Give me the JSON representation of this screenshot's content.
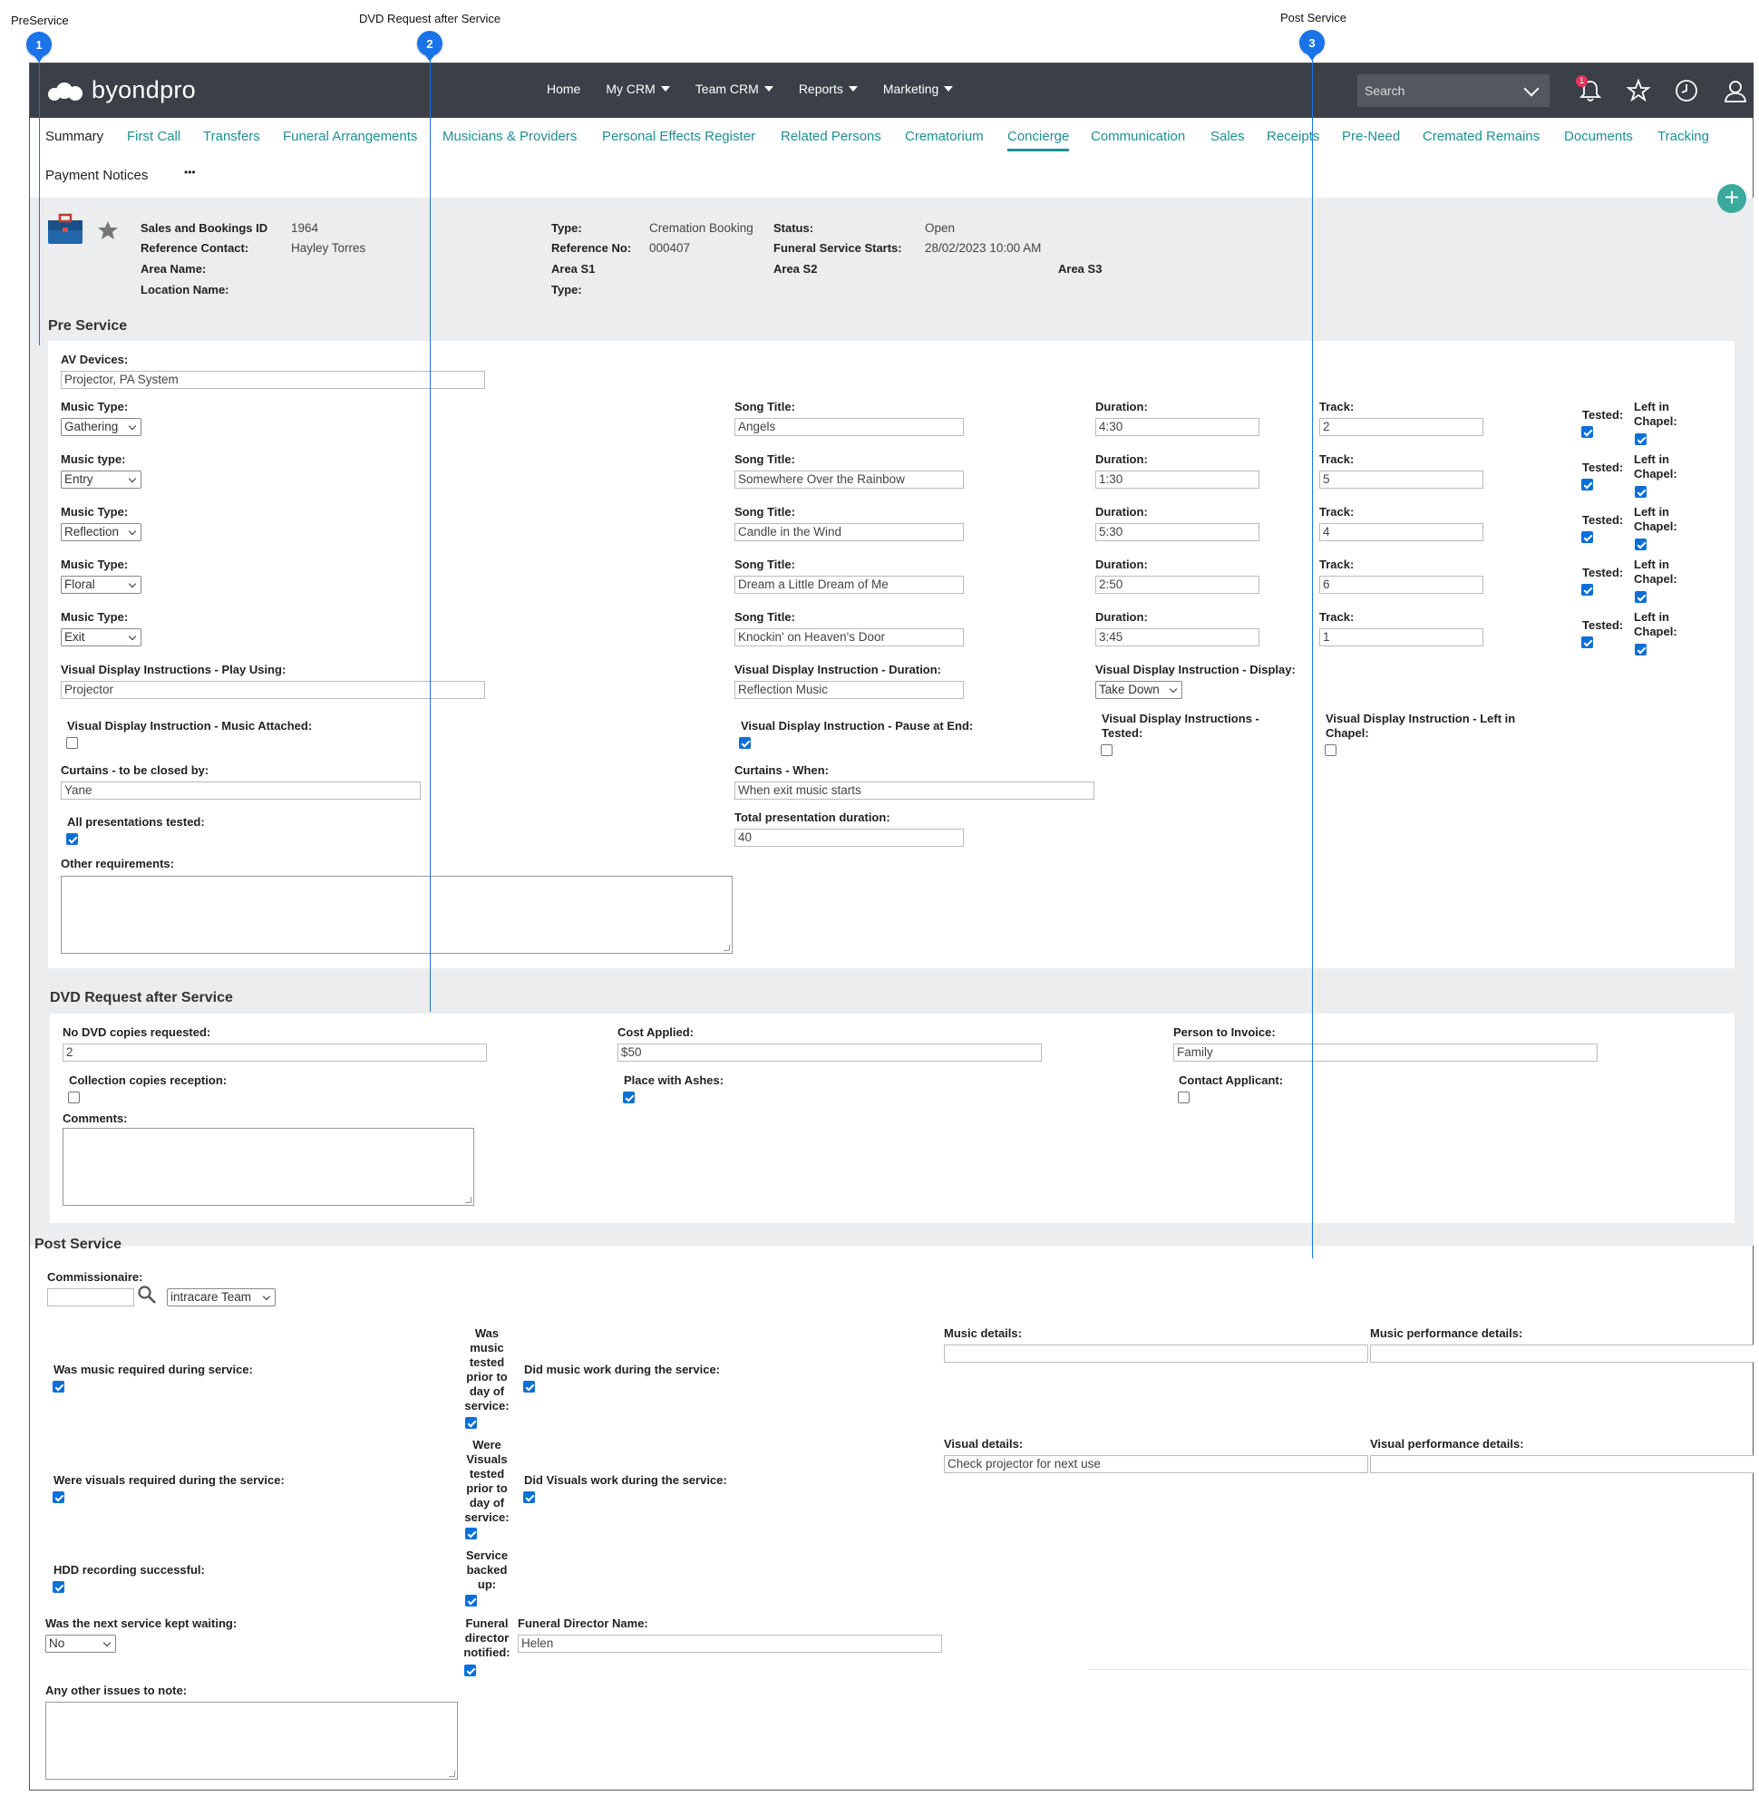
{
  "callouts": [
    {
      "number": "1",
      "label": "PreService"
    },
    {
      "number": "2",
      "label": "DVD Request after Service"
    },
    {
      "number": "3",
      "label": "Post Service"
    }
  ],
  "topbar": {
    "logo_text": "byondpro",
    "nav": [
      "Home",
      "My CRM",
      "Team CRM",
      "Reports",
      "Marketing"
    ],
    "search_placeholder": "Search",
    "notification_count": "1",
    "icons": [
      "bell-icon",
      "star-icon",
      "clock-icon",
      "user-icon"
    ]
  },
  "tabs": [
    "Summary",
    "First Call",
    "Transfers",
    "Funeral Arrangements",
    "Musicians & Providers",
    "Personal Effects Register",
    "Related Persons",
    "Crematorium",
    "Concierge",
    "Communication",
    "Sales",
    "Receipts",
    "Pre-Need",
    "Cremated Remains",
    "Documents",
    "Tracking",
    "Payment Notices",
    "•••"
  ],
  "active_tab": "Concierge",
  "record": {
    "id_label": "Sales and Bookings ID",
    "id_value": "1964",
    "ref_contact_label": "Reference Contact:",
    "ref_contact_value": "Hayley Torres",
    "area_name_label": "Area Name:",
    "location_name_label": "Location Name:",
    "type_label": "Type:",
    "type_value": "Cremation Booking",
    "ref_no_label": "Reference No:",
    "ref_no_value": "000407",
    "area_s1_label": "Area S1",
    "type2_label": "Type:",
    "status_label": "Status:",
    "status_value": "Open",
    "service_starts_label": "Funeral Service Starts:",
    "service_starts_value": "28/02/2023 10:00 AM",
    "area_s2_label": "Area S2",
    "area_s3_label": "Area S3"
  },
  "pre_service": {
    "title": "Pre Service",
    "av_devices_label": "AV Devices:",
    "av_devices_value": "Projector, PA System",
    "music_rows": [
      {
        "type_label": "Music Type:",
        "type": "Gathering",
        "song": "Angels",
        "duration": "4:30",
        "track": "2",
        "tested": true,
        "left": true
      },
      {
        "type_label": "Music type:",
        "type": "Entry",
        "song": "Somewhere Over the Rainbow",
        "duration": "1:30",
        "track": "5",
        "tested": true,
        "left": true
      },
      {
        "type_label": "Music Type:",
        "type": "Reflection",
        "song": "Candle in the Wind",
        "duration": "5:30",
        "track": "4",
        "tested": true,
        "left": true
      },
      {
        "type_label": "Music Type:",
        "type": "Floral",
        "song": "Dream a Little Dream of Me",
        "duration": "2:50",
        "track": "6",
        "tested": true,
        "left": true
      },
      {
        "type_label": "Music Type:",
        "type": "Exit",
        "song": "Knockin' on Heaven's Door",
        "duration": "3:45",
        "track": "1",
        "tested": true,
        "left": true
      }
    ],
    "song_title_label": "Song Title:",
    "duration_label": "Duration:",
    "track_label": "Track:",
    "tested_label": "Tested:",
    "left_in_chapel_label": "Left in Chapel:",
    "vd_play_using_label": "Visual Display Instructions - Play Using:",
    "vd_play_using_value": "Projector",
    "vd_duration_label": "Visual Display Instruction - Duration:",
    "vd_duration_value": "Reflection Music",
    "vd_display_label": "Visual Display Instruction - Display:",
    "vd_display_value": "Take Down",
    "vd_music_attached_label": "Visual Display Instruction - Music Attached:",
    "vd_music_attached": false,
    "vd_pause_label": "Visual Display Instruction - Pause at End:",
    "vd_pause": true,
    "vd_tested_label": "Visual Display Instructions - Tested:",
    "vd_tested": false,
    "vd_left_label": "Visual Display Instruction - Left in Chapel:",
    "vd_left": false,
    "curtains_by_label": "Curtains - to be closed by:",
    "curtains_by_value": "Yane",
    "curtains_when_label": "Curtains - When:",
    "curtains_when_value": "When exit music starts",
    "all_tested_label": "All presentations tested:",
    "all_tested": true,
    "total_duration_label": "Total presentation duration:",
    "total_duration_value": "40",
    "other_req_label": "Other requirements:"
  },
  "dvd": {
    "title": "DVD Request after Service",
    "copies_label": "No DVD copies requested:",
    "copies_value": "2",
    "cost_label": "Cost Applied:",
    "cost_value": "$50",
    "invoice_label": "Person to Invoice:",
    "invoice_value": "Family",
    "collection_label": "Collection copies reception:",
    "collection": false,
    "ashes_label": "Place with Ashes:",
    "ashes": true,
    "contact_label": "Contact Applicant:",
    "contact": false,
    "comments_label": "Comments:"
  },
  "post_service": {
    "title": "Post Service",
    "commissionaire_label": "Commissionaire:",
    "team_value": "intracare Team",
    "music_required_label": "Was music required during service:",
    "music_required": true,
    "music_tested_label": "Was music tested prior to day of service:",
    "music_tested": true,
    "music_worked_label": "Did music work during the service:",
    "music_worked": true,
    "music_details_label": "Music details:",
    "music_details_value": "",
    "music_perf_label": "Music performance details:",
    "visuals_required_label": "Were visuals required during the service:",
    "visuals_required": true,
    "visuals_tested_label": "Were Visuals tested prior to day of service:",
    "visuals_tested": true,
    "visuals_worked_label": "Did Visuals work during the service:",
    "visuals_worked": true,
    "visual_details_label": "Visual details:",
    "visual_details_value": "Check projector for next use",
    "visual_perf_label": "Visual performance details:",
    "hdd_label": "HDD recording successful:",
    "hdd": true,
    "backed_up_label": "Service backed up:",
    "backed_up": true,
    "kept_waiting_label": "Was the next service kept waiting:",
    "kept_waiting_value": "No",
    "fd_notified_label": "Funeral director notified:",
    "fd_notified": true,
    "fd_name_label": "Funeral Director Name:",
    "fd_name_value": "Helen",
    "other_issues_label": "Any other issues to note:"
  },
  "colors": {
    "topbar": "#3b3f48",
    "accent": "#1f8f94",
    "callout": "#1a73e8",
    "checkbox": "#0a6fd8",
    "badge": "#e5325c"
  }
}
